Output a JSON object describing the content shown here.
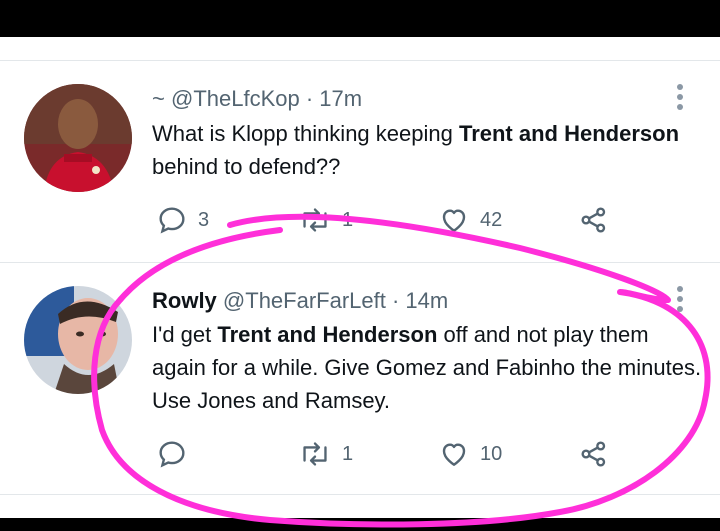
{
  "tweets": [
    {
      "prefix": "~",
      "name": "",
      "handle": "@TheLfcKop",
      "time": "· 17m",
      "text_parts": [
        "What is Klopp thinking keeping ",
        "Trent and Henderson",
        " behind to defend??"
      ],
      "reply_count": "3",
      "retweet_count": "1",
      "like_count": "42"
    },
    {
      "prefix": "",
      "name": "Rowly",
      "handle": "@TheFarFarLeft",
      "time": "· 14m",
      "text_parts": [
        "I'd get ",
        "Trent and Henderson",
        " off and not play them again for a while. Give Gomez and Fabinho the minutes. Use Jones and Ramsey."
      ],
      "reply_count": "",
      "retweet_count": "1",
      "like_count": "10"
    }
  ],
  "icons": {
    "reply": "reply-icon",
    "retweet": "retweet-icon",
    "like": "heart-icon",
    "share": "share-icon",
    "more": "more-options-icon"
  },
  "colors": {
    "annotation": "#ff2fd9",
    "muted": "#536471"
  }
}
